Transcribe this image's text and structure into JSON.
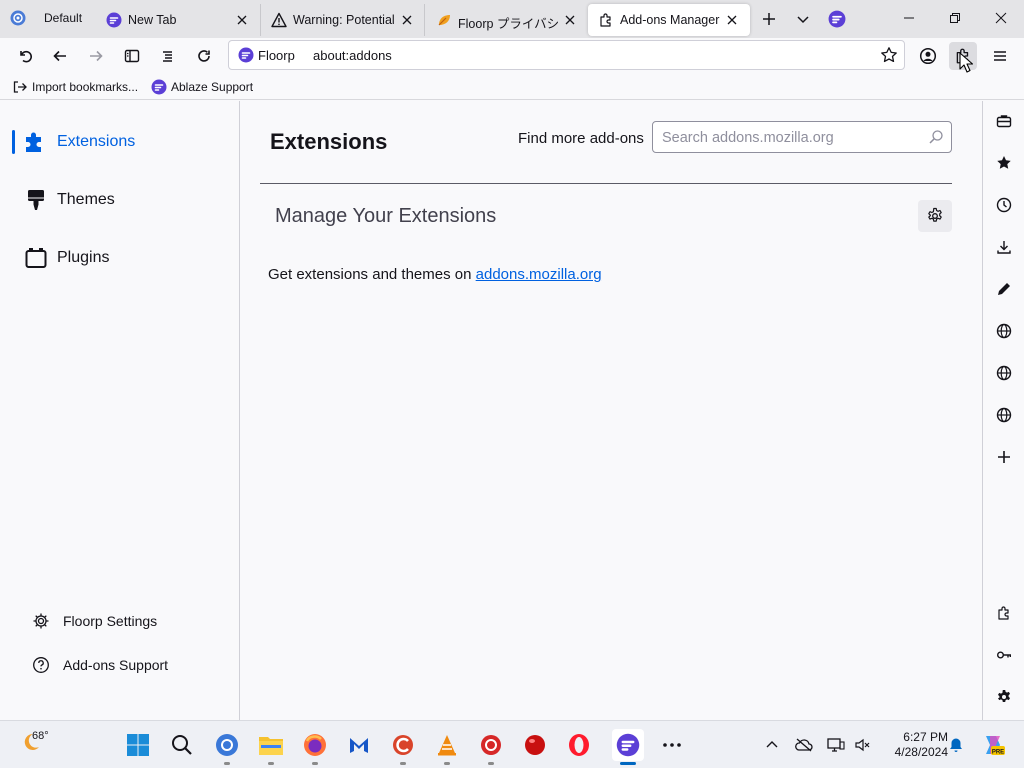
{
  "browser": {
    "profile_label": "Default",
    "tabs": [
      {
        "title": "New Tab"
      },
      {
        "title": "Warning: Potential S"
      },
      {
        "title": "Floorp プライバシー"
      },
      {
        "title": "Add-ons Manager"
      }
    ],
    "url_brand": "Floorp",
    "url": "about:addons"
  },
  "bookmarks": [
    {
      "label": "Import bookmarks..."
    },
    {
      "label": "Ablaze Support"
    }
  ],
  "sidebar": {
    "items": [
      {
        "label": "Extensions",
        "icon": "puzzle-icon",
        "selected": true
      },
      {
        "label": "Themes",
        "icon": "brush-icon"
      },
      {
        "label": "Plugins",
        "icon": "plugin-icon"
      }
    ],
    "footer": [
      {
        "label": "Floorp Settings",
        "icon": "gear-icon"
      },
      {
        "label": "Add-ons Support",
        "icon": "help-icon"
      }
    ]
  },
  "main": {
    "title": "Extensions",
    "find_more": "Find more add-ons",
    "search_placeholder": "Search addons.mozilla.org",
    "subtitle": "Manage Your Extensions",
    "get_text": "Get extensions and themes on",
    "get_link": "addons.mozilla.org"
  },
  "taskbar": {
    "temperature": "68°",
    "time": "6:27 PM",
    "date": "4/28/2024"
  },
  "colors": {
    "accent": "#0061e0",
    "floorp": "#5b3fd6"
  }
}
